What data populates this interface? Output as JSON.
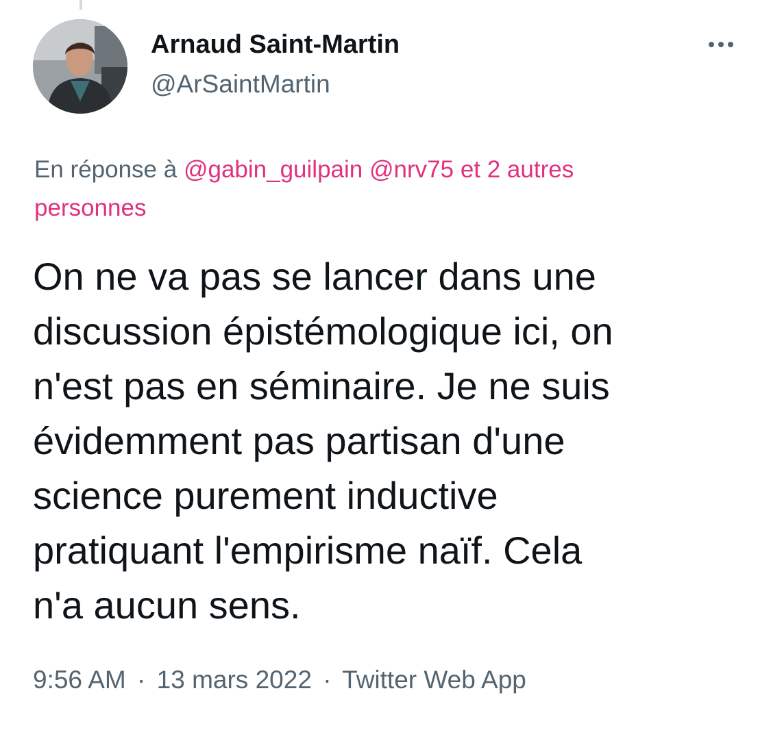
{
  "author": {
    "display_name": "Arnaud Saint-Martin",
    "handle": "@ArSaintMartin",
    "avatar_icon": "profile-photo"
  },
  "more_icon": "more-horizontal-icon",
  "reply_context": {
    "prefix": "En réponse à",
    "mentions": [
      "@gabin_guilpain",
      "@nrv75"
    ],
    "others": "et 2 autres personnes"
  },
  "tweet": {
    "text": "On ne va pas se lancer dans une\ndiscussion épistémologique ici, on\nn'est pas en séminaire. Je ne suis\névidemment pas partisan d'une\nscience purement inductive\npratiquant l'empirisme naïf. Cela\nn'a aucun sens."
  },
  "meta": {
    "time": "9:56 AM",
    "separator": "·",
    "date": "13 mars 2022",
    "source": "Twitter Web App"
  },
  "colors": {
    "accent": "#e0317f",
    "secondary_text": "#536471",
    "primary_text": "#0f1419"
  }
}
